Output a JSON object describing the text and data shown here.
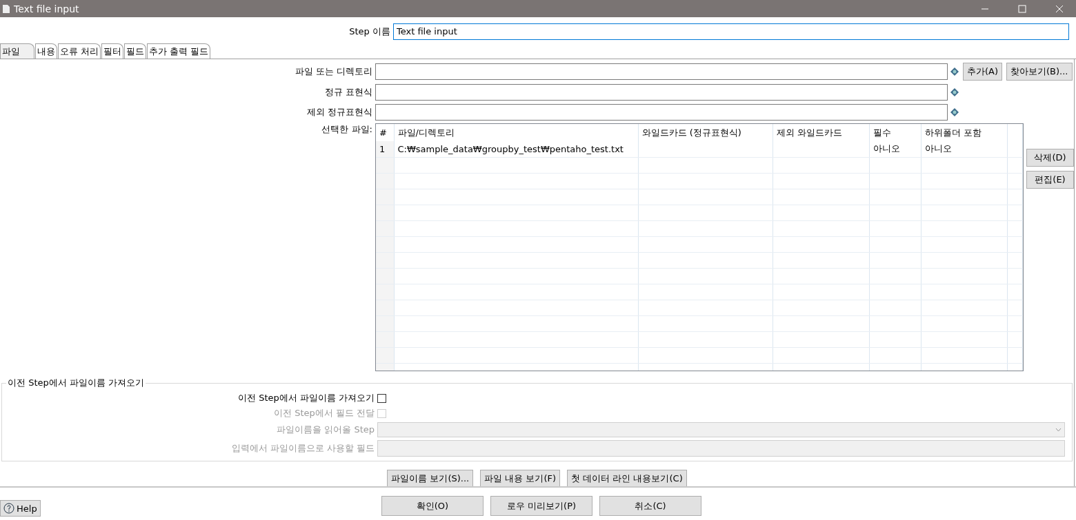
{
  "window": {
    "title": "Text file input"
  },
  "step_name": {
    "label": "Step 이름",
    "value": "Text file input"
  },
  "tabs": [
    {
      "label": "파일",
      "selected": true
    },
    {
      "label": "내용",
      "selected": false
    },
    {
      "label": "오류 처리",
      "selected": false
    },
    {
      "label": "필터",
      "selected": false
    },
    {
      "label": "필드",
      "selected": false
    },
    {
      "label": "추가 출력 필드",
      "selected": false
    }
  ],
  "file_fields": [
    {
      "label": "파일 또는 디렉토리",
      "buttons": [
        "추가(A)",
        "찾아보기(B)..."
      ]
    },
    {
      "label": "정규 표현식"
    },
    {
      "label": "제외 정규표현식"
    }
  ],
  "selected_files": {
    "label": "선택한 파일:",
    "columns": [
      "#",
      "파일/디렉토리",
      "와일드카드 (정규표현식)",
      "제외 와일드카드",
      "필수",
      "하위폴더 포함"
    ],
    "rows": [
      [
        "1",
        "C:₩sample_data₩groupby_test₩pentaho_test.txt",
        "",
        "",
        "아니오",
        "아니오"
      ]
    ],
    "buttons": [
      "삭제(D)",
      "편집(E)"
    ]
  },
  "previous_step": {
    "title": "이전 Step에서 파일이름 가져오기",
    "items": [
      {
        "kind": "checkbox",
        "label": "이전 Step에서 파일이름 가져오기",
        "checked": false,
        "disabled": false
      },
      {
        "kind": "checkbox",
        "label": "이전 Step에서 필드 전달",
        "checked": false,
        "disabled": true
      },
      {
        "kind": "dropdown",
        "label": "파일이름을 읽어올 Step",
        "disabled": true
      },
      {
        "kind": "text",
        "label": "입력에서 파일이름으로 사용할 필드",
        "disabled": true
      }
    ]
  },
  "actions": [
    "파일이름 보기(S)...",
    "파일 내용 보기(F)",
    "첫 데이터 라인 내용보기(C)"
  ],
  "footer": {
    "help": "Help",
    "buttons": [
      "확인(O)",
      "로우 미리보기(P)",
      "취소(C)"
    ]
  }
}
